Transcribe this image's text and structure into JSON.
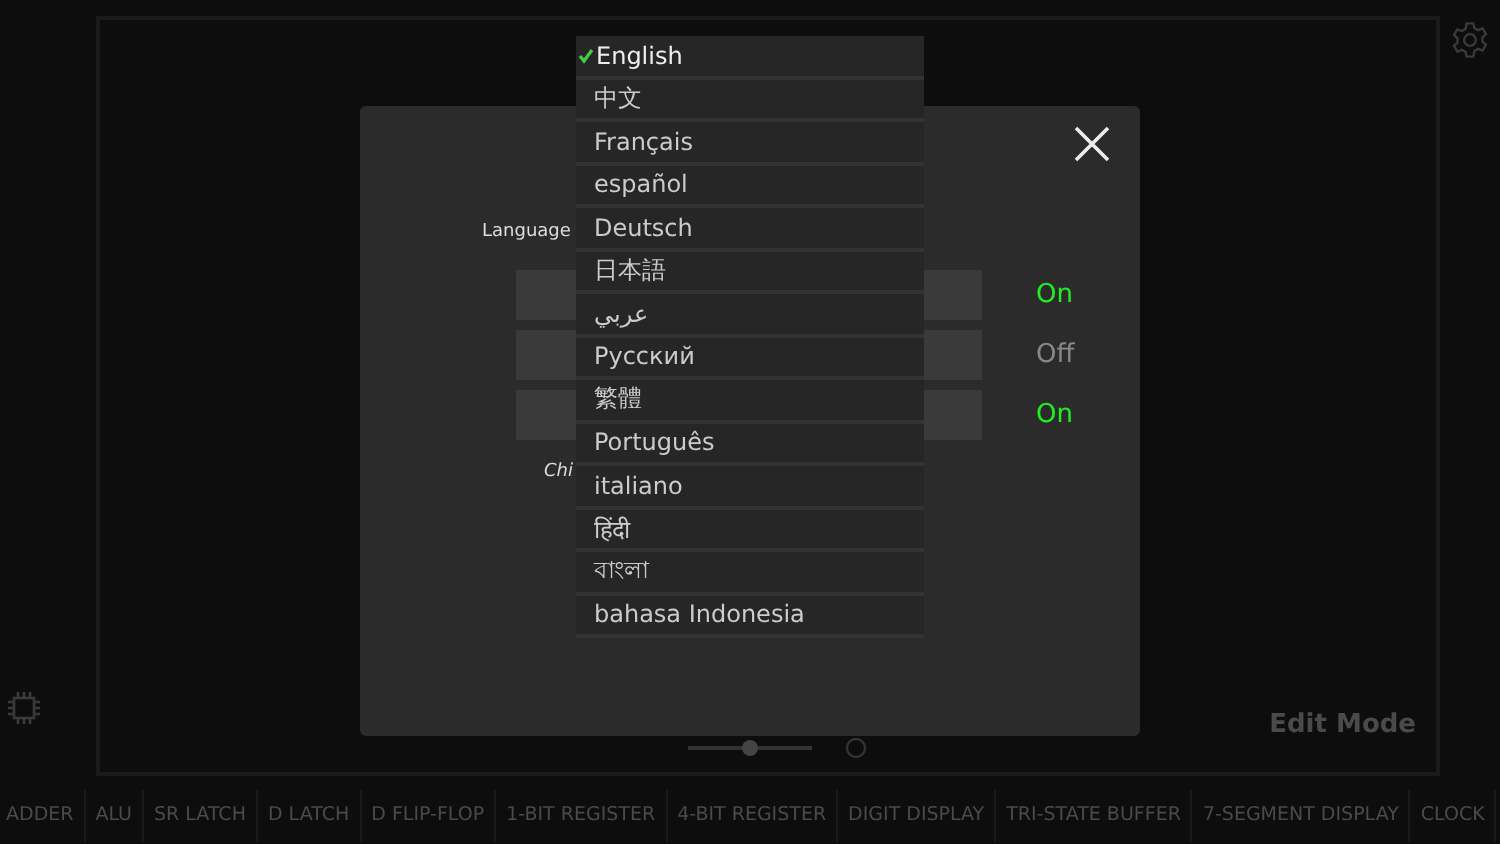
{
  "settings_dialog": {
    "language_label": "Language",
    "toggles": [
      {
        "value": "On",
        "on": true
      },
      {
        "value": "Off",
        "on": false
      },
      {
        "value": "On",
        "on": true
      }
    ],
    "chip_label": "Chi"
  },
  "language_menu": [
    {
      "label": "English",
      "selected": true
    },
    {
      "label": "中文",
      "selected": false
    },
    {
      "label": "Français",
      "selected": false
    },
    {
      "label": "español",
      "selected": false
    },
    {
      "label": "Deutsch",
      "selected": false
    },
    {
      "label": "日本語",
      "selected": false
    },
    {
      "label": "عربي",
      "selected": false
    },
    {
      "label": "Русский",
      "selected": false
    },
    {
      "label": "繁體",
      "selected": false
    },
    {
      "label": "Português",
      "selected": false
    },
    {
      "label": "italiano",
      "selected": false
    },
    {
      "label": "हिंदी",
      "selected": false
    },
    {
      "label": "বাংলা",
      "selected": false
    },
    {
      "label": "bahasa Indonesia",
      "selected": false
    }
  ],
  "mode_label": "Edit Mode",
  "zoom": {
    "level": 0.5
  },
  "component_bar": [
    "ADDER",
    "ALU",
    "SR LATCH",
    "D LATCH",
    "D FLIP-FLOP",
    "1-BIT REGISTER",
    "4-BIT REGISTER",
    "DIGIT DISPLAY",
    "TRI-STATE BUFFER",
    "7-SEGMENT DISPLAY",
    "CLOCK"
  ]
}
